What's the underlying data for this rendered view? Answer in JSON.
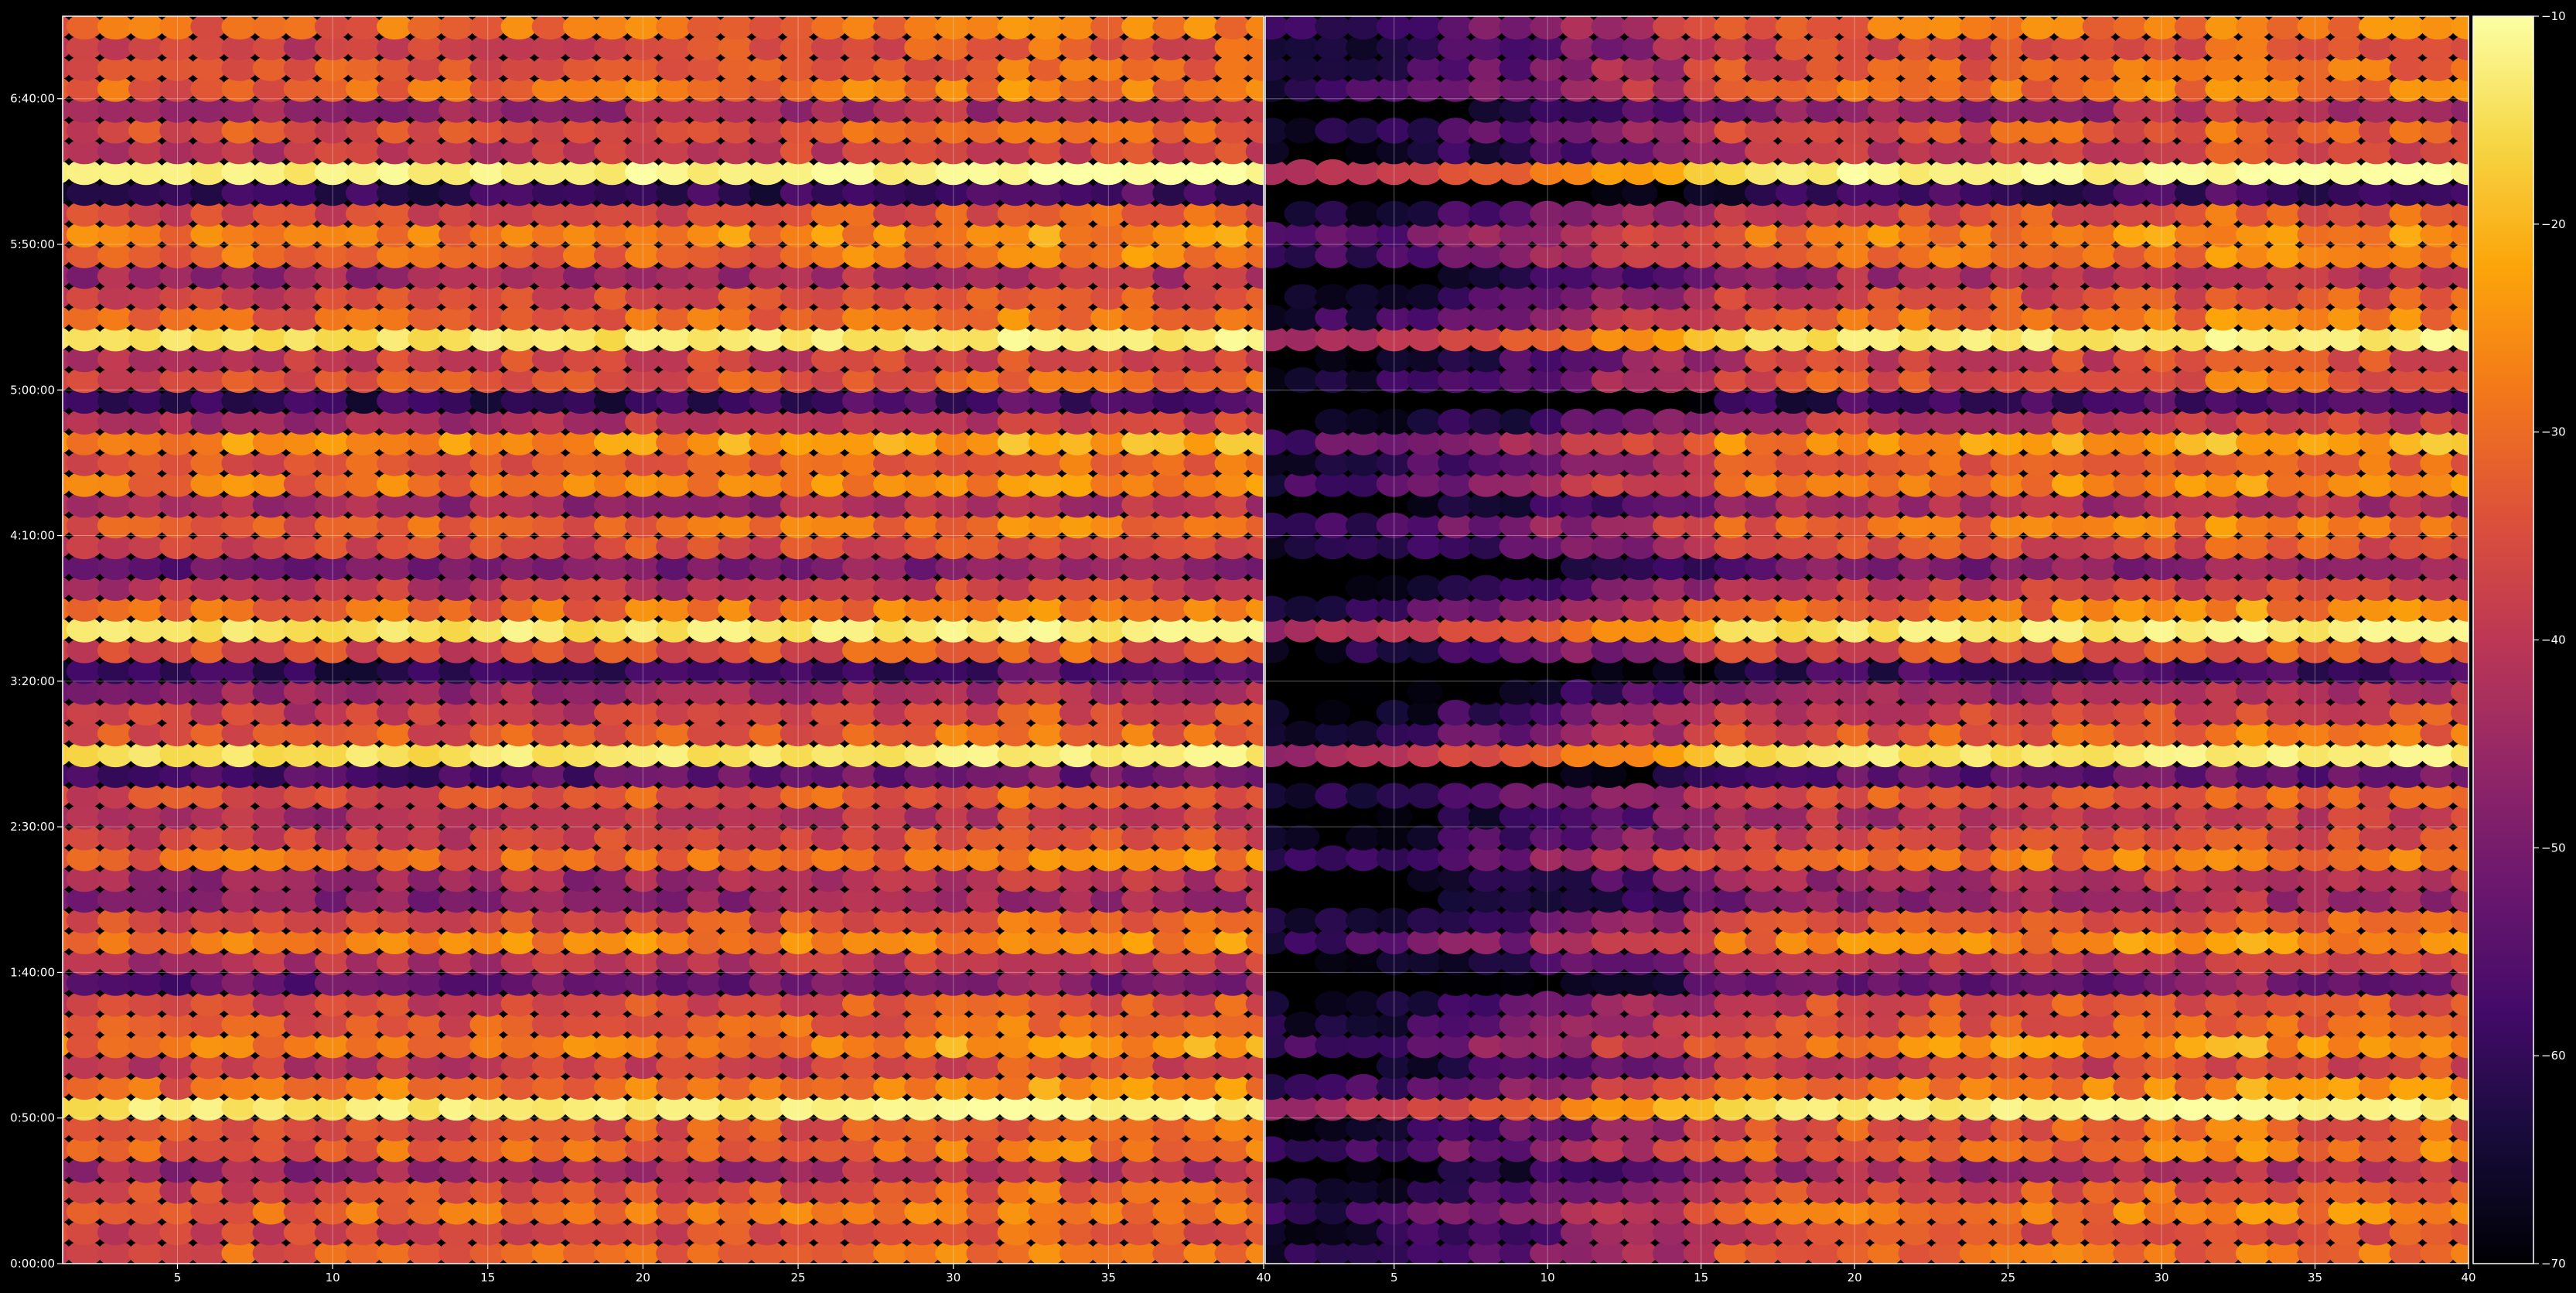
{
  "chart_data": {
    "type": "heatmap",
    "title": "",
    "xlabel": "",
    "ylabel": "",
    "grid": true,
    "colormap": "inferno",
    "colorbar": {
      "range": [
        -70,
        -10
      ],
      "ticks": [
        -70,
        -60,
        -50,
        -40,
        -30,
        -20,
        -10
      ],
      "tick_labels": [
        "−70",
        "−60",
        "−50",
        "−40",
        "−30",
        "−20",
        "−10"
      ]
    },
    "y_ticks": [
      {
        "seconds": 0,
        "label": "0:00:00"
      },
      {
        "seconds": 3000,
        "label": "0:50:00"
      },
      {
        "seconds": 6000,
        "label": "1:40:00"
      },
      {
        "seconds": 9000,
        "label": "2:30:00"
      },
      {
        "seconds": 12000,
        "label": "3:20:00"
      },
      {
        "seconds": 15000,
        "label": "4:10:00"
      },
      {
        "seconds": 18000,
        "label": "5:00:00"
      },
      {
        "seconds": 21000,
        "label": "5:50:00"
      },
      {
        "seconds": 24000,
        "label": "6:40:00"
      }
    ],
    "ylim_seconds": [
      0,
      25700
    ],
    "panels": [
      {
        "name": "left",
        "xlim": [
          1.3,
          40
        ],
        "x_ticks": [
          5,
          10,
          15,
          20,
          25,
          30,
          35,
          40
        ],
        "x_tick_labels": [
          "5",
          "10",
          "15",
          "20",
          "25",
          "30",
          "35",
          "40"
        ]
      },
      {
        "name": "right",
        "xlim": [
          0.8,
          40
        ],
        "x_ticks": [
          5,
          10,
          15,
          20,
          25,
          30,
          35,
          40
        ],
        "x_tick_labels": [
          "5",
          "10",
          "15",
          "20",
          "25",
          "30",
          "35",
          "40"
        ]
      }
    ],
    "channels": 40,
    "rows": 60,
    "row_profile_db": [
      -32,
      -36,
      -30,
      -35,
      -44,
      -31,
      -34,
      -40,
      -29,
      -38,
      -27,
      -33,
      -36,
      -52,
      -41,
      -28,
      -35,
      -47,
      -44,
      -30,
      -37,
      -42,
      -34,
      -55,
      -29,
      -33,
      -38,
      -45,
      -60,
      -35,
      -24,
      -30,
      -40,
      -50,
      -36,
      -31,
      -44,
      -28,
      -33,
      -25,
      -41,
      -60,
      -34,
      -38,
      -26,
      -31,
      -36,
      -44,
      -30,
      -27,
      -35,
      -60,
      -28,
      -39,
      -34,
      -45,
      -30,
      -33,
      -36,
      -30
    ],
    "channel_profile_db": [
      -2,
      -2,
      -1,
      -1,
      -2,
      -1,
      0,
      -1,
      -2,
      -1,
      -1,
      0,
      -1,
      -1,
      0,
      1,
      0,
      -1,
      0,
      1,
      0,
      1,
      1,
      0,
      1,
      1,
      2,
      1,
      2,
      3,
      2,
      4,
      5,
      3,
      2,
      3,
      2,
      3,
      3,
      3
    ],
    "right_panel_attenuation_db": [
      -30,
      -30,
      -28,
      -28,
      -26,
      -24,
      -22,
      -20,
      -18,
      -16,
      -14,
      -12,
      -10,
      -8,
      -6,
      -3,
      -1,
      0,
      0,
      0,
      0,
      0,
      0,
      0,
      0,
      0,
      0,
      0,
      0,
      0,
      0,
      0,
      0,
      0,
      0,
      0,
      0,
      0,
      0,
      0
    ],
    "highlight_rows": [
      {
        "row": 7,
        "db": -13
      },
      {
        "row": 24,
        "db": -14
      },
      {
        "row": 30,
        "db": -14
      },
      {
        "row": 44,
        "db": -14
      },
      {
        "row": 52,
        "db": -12
      }
    ]
  }
}
